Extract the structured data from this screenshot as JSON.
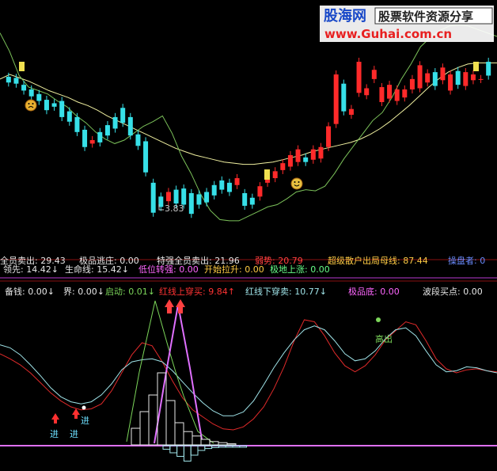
{
  "watermark": {
    "logo": "股海网",
    "tagline": "股票软件资源分享",
    "url": "www.Guhai.com.cn"
  },
  "colors": {
    "bg": "#000000",
    "up_candle": "#ff2a2a",
    "down_candle": "#37e0e8",
    "yellow_line": "#f0f0a0",
    "green_line": "#7cc25a",
    "red_line": "#e02a2a",
    "cyan_line": "#9fe3e8",
    "magenta": "#e070ff"
  },
  "price_panel": {
    "low_label": "3.83",
    "bottom_row_clipped": [
      "全员卖出: 29.43",
      "极品逃庄: 0.00",
      "特强全员卖出: 21.96",
      "弱势: 20.79",
      "超级散户出局母线: 87.44",
      "操盘者: 0"
    ]
  },
  "info_row": [
    {
      "text": "领先: 14.42",
      "arrow": "↓",
      "color": "#e8e8e8"
    },
    {
      "text": "生命线: 15.42",
      "arrow": "↓",
      "color": "#e8e8e8"
    },
    {
      "text": "低位转强: 0.00",
      "arrow": "",
      "color": "#ff66ff"
    },
    {
      "text": "开始拉升: 0.00",
      "arrow": "",
      "color": "#ffcc44"
    },
    {
      "text": "极地上涨: 0.00",
      "arrow": "",
      "color": "#66ff88"
    }
  ],
  "indicator_row": [
    {
      "text": "备钱: 0.00",
      "arrow": "↓",
      "color": "#e8e8e8"
    },
    {
      "text": "界: 0.00",
      "arrow": "↓",
      "color": "#e8e8e8"
    },
    {
      "text": "启动: 0.01",
      "arrow": "↓",
      "color": "#7cd65a"
    },
    {
      "text": "红线上穿买: 9.84",
      "arrow": "↑",
      "color": "#ff3333"
    },
    {
      "text": "红线下穿卖: 10.77",
      "arrow": "↓",
      "color": "#9fe3e8"
    },
    {
      "text": "极品底: 0.00",
      "arrow": "",
      "color": "#ff66ff"
    },
    {
      "text": "波段买点: 0.00",
      "arrow": "",
      "color": "#e8e8e8"
    }
  ],
  "annotations": {
    "buy_labels": [
      "进",
      "进",
      "进"
    ],
    "sell_label": "高出"
  },
  "chart_data": {
    "type": "candlestick",
    "candles": [
      {
        "o": 16.4,
        "c": 15.9
      },
      {
        "o": 16.3,
        "c": 15.8
      },
      {
        "o": 15.7,
        "c": 15.2
      },
      {
        "o": 15.3,
        "c": 14.7
      },
      {
        "o": 14.9,
        "c": 14.3
      },
      {
        "o": 14.4,
        "c": 13.5
      },
      {
        "o": 14.1,
        "c": 13.8
      },
      {
        "o": 14.3,
        "c": 12.9
      },
      {
        "o": 13.4,
        "c": 12.5
      },
      {
        "o": 12.9,
        "c": 11.6
      },
      {
        "o": 11.8,
        "c": 10.3
      },
      {
        "o": 10.6,
        "c": 10.9
      },
      {
        "o": 11.6,
        "c": 10.7
      },
      {
        "o": 12.2,
        "c": 11.3
      },
      {
        "o": 12.9,
        "c": 11.9
      },
      {
        "o": 13.7,
        "c": 12.4
      },
      {
        "o": 12.9,
        "c": 11.3
      },
      {
        "o": 11.4,
        "c": 10.4
      },
      {
        "o": 10.8,
        "c": 8.1
      },
      {
        "o": 7.2,
        "c": 4.6
      },
      {
        "o": 6.0,
        "c": 5.1
      },
      {
        "o": 5.6,
        "c": 6.4
      },
      {
        "o": 6.6,
        "c": 5.4
      },
      {
        "o": 6.7,
        "c": 5.3
      },
      {
        "o": 6.3,
        "c": 4.5
      },
      {
        "o": 6.2,
        "c": 5.3
      },
      {
        "o": 6.4,
        "c": 5.5
      },
      {
        "o": 7.0,
        "c": 6.1
      },
      {
        "o": 7.4,
        "c": 6.6
      },
      {
        "o": 7.2,
        "c": 6.4
      },
      {
        "o": 7.0,
        "c": 7.6
      },
      {
        "o": 6.3,
        "c": 5.2
      },
      {
        "o": 5.9,
        "c": 5.3
      },
      {
        "o": 6.0,
        "c": 6.9
      },
      {
        "o": 7.2,
        "c": 7.8
      },
      {
        "o": 7.6,
        "c": 8.2
      },
      {
        "o": 8.3,
        "c": 8.9
      },
      {
        "o": 8.6,
        "c": 9.6
      },
      {
        "o": 9.0,
        "c": 10.1
      },
      {
        "o": 9.4,
        "c": 9.0
      },
      {
        "o": 9.2,
        "c": 10.1
      },
      {
        "o": 9.3,
        "c": 10.3
      },
      {
        "o": 10.3,
        "c": 12.1
      },
      {
        "o": 12.3,
        "c": 16.6
      },
      {
        "o": 15.8,
        "c": 13.4
      },
      {
        "o": 13.1,
        "c": 13.6
      },
      {
        "o": 15.0,
        "c": 17.7
      },
      {
        "o": 14.8,
        "c": 15.4
      },
      {
        "o": 16.2,
        "c": 17.0
      },
      {
        "o": 14.2,
        "c": 15.5
      },
      {
        "o": 14.5,
        "c": 15.7
      },
      {
        "o": 14.3,
        "c": 15.3
      },
      {
        "o": 14.6,
        "c": 15.3
      },
      {
        "o": 15.3,
        "c": 16.2
      },
      {
        "o": 15.4,
        "c": 17.4
      },
      {
        "o": 15.9,
        "c": 16.7
      },
      {
        "o": 16.8,
        "c": 15.6
      },
      {
        "o": 16.1,
        "c": 17.2
      },
      {
        "o": 15.2,
        "c": 16.6
      },
      {
        "o": 16.9,
        "c": 15.7
      },
      {
        "o": 15.6,
        "c": 16.8
      },
      {
        "o": 16.1,
        "c": 16.6
      },
      {
        "o": 16.2,
        "c": 16.2
      },
      {
        "o": 17.7,
        "c": 16.5
      }
    ],
    "ylim": [
      3,
      21
    ],
    "low_marker": 3.83,
    "yellow_ma": [
      16.2,
      16.6,
      16.3,
      16.0,
      15.6,
      15.2,
      14.9,
      14.6,
      14.2,
      13.9,
      13.5,
      13.0,
      12.6,
      12.2,
      11.8,
      11.4,
      11.0,
      10.6,
      10.2,
      9.9,
      9.6,
      9.4,
      9.2,
      9.0,
      8.9,
      8.8,
      8.8,
      8.9,
      9.0,
      9.2,
      9.4,
      9.6,
      9.9,
      10.1,
      10.3,
      10.5,
      10.7,
      11.0,
      11.4,
      11.9,
      12.5,
      13.2,
      13.9,
      14.7,
      15.5,
      16.2,
      16.8,
      17.2,
      17.5,
      17.6,
      17.6,
      17.6
    ],
    "green_band": [
      20.2,
      18.6,
      16.5,
      15.5,
      15.2,
      14.9,
      14.3,
      13.8,
      13.0,
      12.4,
      11.6,
      11.0,
      10.6,
      10.9,
      11.5,
      12.1,
      12.5,
      13.0,
      11.5,
      9.5,
      8.0,
      6.2,
      4.8,
      4.0,
      3.9,
      3.9,
      4.3,
      4.7,
      5.1,
      5.3,
      5.8,
      6.4,
      6.6,
      6.5,
      6.9,
      8.0,
      9.3,
      10.4,
      11.5,
      12.6,
      13.3,
      14.6,
      16.2,
      17.5,
      19.0,
      19.8,
      20.4,
      20.8,
      20.9,
      20.8,
      20.5,
      20.2,
      19.9
    ],
    "red_line": [
      12.1,
      11.6,
      11.0,
      10.2,
      9.2,
      8.2,
      7.4,
      6.8,
      6.5,
      6.6,
      7.1,
      8.4,
      10.2,
      12.0,
      13.2,
      12.9,
      11.3,
      9.4,
      7.7,
      6.5,
      5.8,
      5.1,
      4.6,
      4.5,
      4.8,
      5.6,
      6.8,
      8.6,
      10.8,
      13.4,
      15.5,
      15.3,
      13.9,
      12.2,
      10.9,
      10.3,
      10.9,
      12.0,
      13.5,
      14.4,
      15.3,
      15.0,
      13.4,
      11.6,
      10.6,
      10.2,
      10.5,
      10.6,
      10.4,
      10.3
    ],
    "cyan_line": [
      13.0,
      12.7,
      12.0,
      11.0,
      9.9,
      8.7,
      7.8,
      7.3,
      7.1,
      7.3,
      8.0,
      9.1,
      10.5,
      11.3,
      11.5,
      11.6,
      11.3,
      10.4,
      9.3,
      8.2,
      7.2,
      6.4,
      5.9,
      5.9,
      6.3,
      7.4,
      9.0,
      10.7,
      12.2,
      13.5,
      14.5,
      14.9,
      14.5,
      13.4,
      12.1,
      11.4,
      11.6,
      12.4,
      13.6,
      14.5,
      14.7,
      13.9,
      12.4,
      11.0,
      10.3,
      10.4,
      10.8,
      10.7,
      10.4,
      10.2
    ],
    "spike_green": [
      [
        160,
        558
      ],
      [
        176,
        470
      ],
      [
        196,
        380
      ],
      [
        213,
        440
      ],
      [
        222,
        470
      ],
      [
        232,
        500
      ],
      [
        250,
        545
      ],
      [
        270,
        560
      ]
    ],
    "spike_magenta": [
      [
        195,
        560
      ],
      [
        210,
        470
      ],
      [
        225,
        385
      ],
      [
        240,
        465
      ],
      [
        255,
        555
      ]
    ],
    "histogram": [
      0.15,
      0.3,
      0.45,
      0.65,
      0.4,
      0.2,
      0.12,
      0.08,
      0.05,
      0.03,
      0.02,
      0.01
    ]
  }
}
